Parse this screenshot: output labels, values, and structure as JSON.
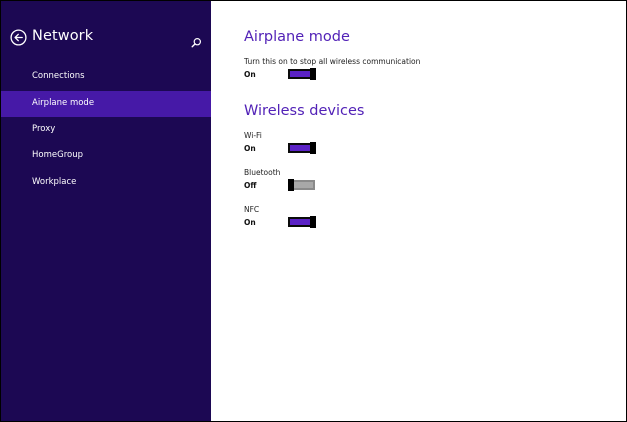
{
  "sidebar": {
    "title": "Network",
    "back_icon": "arrow-left-circle-icon",
    "search_icon": "search-icon",
    "items": [
      {
        "label": "Connections",
        "selected": false
      },
      {
        "label": "Airplane mode",
        "selected": true
      },
      {
        "label": "Proxy",
        "selected": false
      },
      {
        "label": "HomeGroup",
        "selected": false
      },
      {
        "label": "Workplace",
        "selected": false
      }
    ]
  },
  "airplane_mode": {
    "heading": "Airplane mode",
    "description": "Turn this on to stop all wireless communication",
    "state": "On",
    "enabled": true
  },
  "wireless_devices": {
    "heading": "Wireless devices",
    "devices": [
      {
        "name": "Wi-Fi",
        "state": "On",
        "enabled": true
      },
      {
        "name": "Bluetooth",
        "state": "Off",
        "enabled": false
      },
      {
        "name": "NFC",
        "state": "On",
        "enabled": true
      }
    ]
  },
  "colors": {
    "sidebar_bg": "#1c0853",
    "selected_bg": "#4619a7",
    "heading": "#5222b7",
    "toggle_on": "#5b22c6",
    "toggle_off": "#a8a8a8"
  }
}
